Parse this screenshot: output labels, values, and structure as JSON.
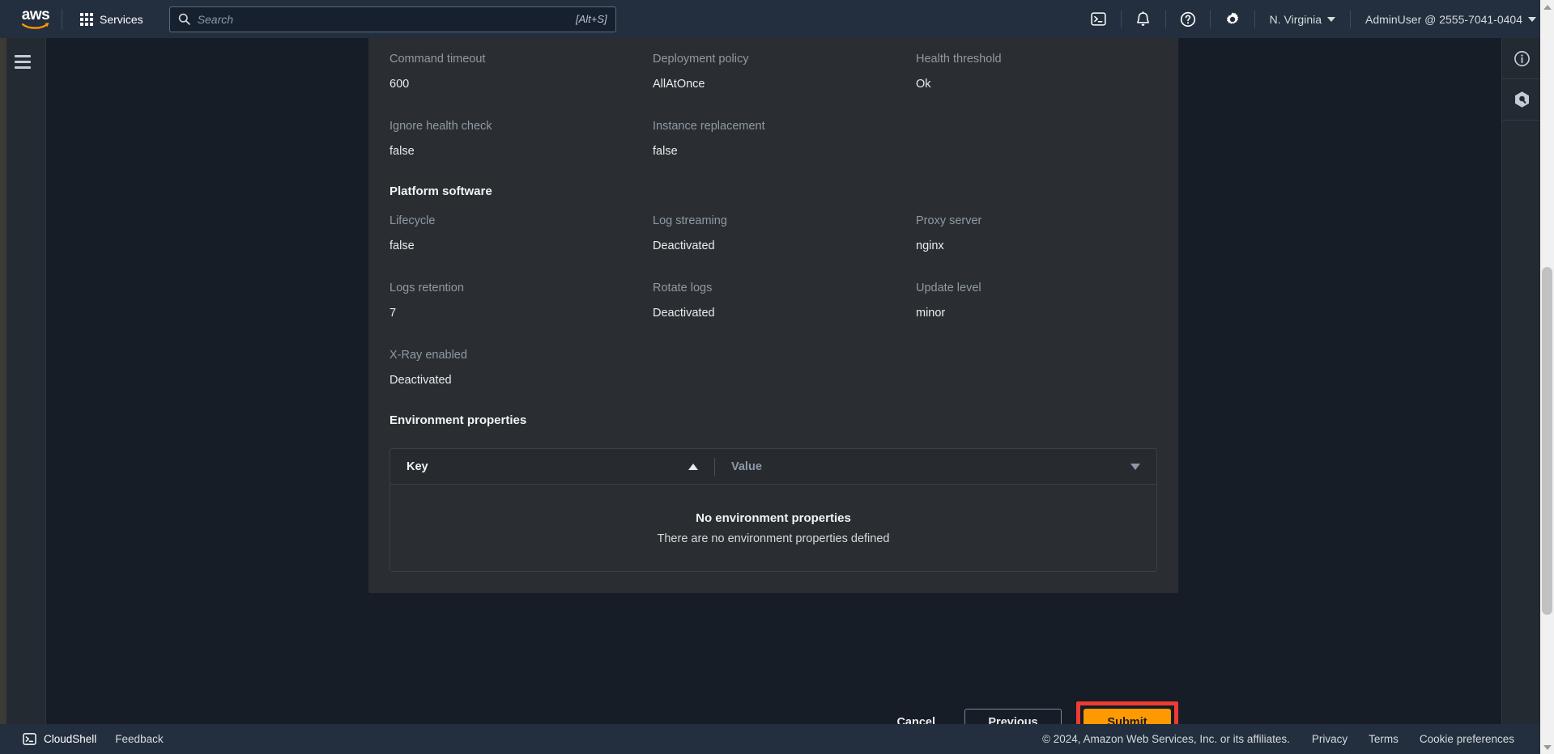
{
  "topnav": {
    "logo_alt": "aws",
    "services_label": "Services",
    "search": {
      "placeholder": "Search",
      "value": "",
      "shortcut_hint": "[Alt+S]"
    },
    "icons": [
      {
        "name": "cloudshell-icon",
        "title": "CloudShell"
      },
      {
        "name": "notifications-bell-icon",
        "title": "Notifications"
      },
      {
        "name": "help-question-icon",
        "title": "Help"
      },
      {
        "name": "settings-gear-icon",
        "title": "Settings"
      }
    ],
    "region_label": "N. Virginia",
    "account_label": "AdminUser @ 2555-7041-0404"
  },
  "right_rail": {
    "info_title": "Info panel",
    "assistant_title": "Amazon Q"
  },
  "main": {
    "sections": [
      {
        "title": "",
        "fields": [
          {
            "label": "Command timeout",
            "value": "600"
          },
          {
            "label": "Deployment policy",
            "value": "AllAtOnce"
          },
          {
            "label": "Health threshold",
            "value": "Ok"
          },
          {
            "label": "Ignore health check",
            "value": "false"
          },
          {
            "label": "Instance replacement",
            "value": "false"
          },
          {
            "label": "",
            "value": ""
          }
        ]
      },
      {
        "title": "Platform software",
        "fields": [
          {
            "label": "Lifecycle",
            "value": "false"
          },
          {
            "label": "Log streaming",
            "value": "Deactivated"
          },
          {
            "label": "Proxy server",
            "value": "nginx"
          },
          {
            "label": "Logs retention",
            "value": "7"
          },
          {
            "label": "Rotate logs",
            "value": "Deactivated"
          },
          {
            "label": "Update level",
            "value": "minor"
          },
          {
            "label": "X-Ray enabled",
            "value": "Deactivated"
          },
          {
            "label": "",
            "value": ""
          },
          {
            "label": "",
            "value": ""
          }
        ]
      }
    ],
    "env_properties": {
      "title": "Environment properties",
      "columns": [
        {
          "label": "Key",
          "sort": "ascending",
          "active": true
        },
        {
          "label": "Value",
          "sort": "descending",
          "active": false
        }
      ],
      "rows": [],
      "empty_title": "No environment properties",
      "empty_subtitle": "There are no environment properties defined"
    }
  },
  "actions": {
    "cancel_label": "Cancel",
    "previous_label": "Previous",
    "submit_label": "Submit",
    "submit_highlight_color": "#ee3b33",
    "submit_background": "#ff9900"
  },
  "footer": {
    "cloudshell_label": "CloudShell",
    "feedback_label": "Feedback",
    "copyright": "© 2024, Amazon Web Services, Inc. or its affiliates.",
    "links": [
      "Privacy",
      "Terms",
      "Cookie preferences"
    ]
  },
  "theme": {
    "topnav_bg": "#232f3e",
    "page_bg": "#161d26",
    "card_bg": "#2a2e33",
    "accent": "#ff9900",
    "label_color": "#8f99a3",
    "value_color": "#e9ebed"
  }
}
